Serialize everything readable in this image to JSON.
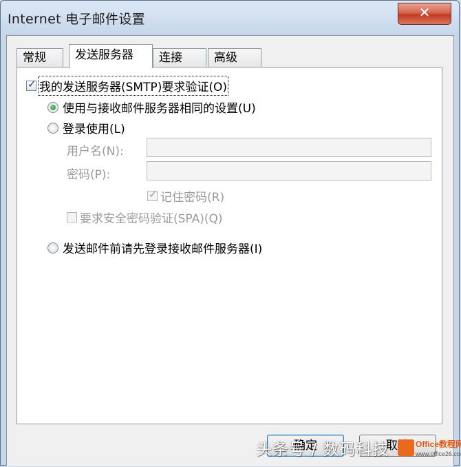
{
  "window": {
    "title": "Internet 电子邮件设置",
    "close_glyph": "✕"
  },
  "tabs": [
    {
      "label": "常规",
      "active": false
    },
    {
      "label": "发送服务器",
      "active": true
    },
    {
      "label": "连接",
      "active": false
    },
    {
      "label": "高级",
      "active": false
    }
  ],
  "smtp_auth": {
    "label": "我的发送服务器(SMTP)要求验证(O)",
    "checked": true
  },
  "same_settings": {
    "label": "使用与接收邮件服务器相同的设置(U)",
    "selected": true
  },
  "login_with": {
    "label": "登录使用(L)",
    "selected": false
  },
  "username": {
    "label": "用户名(N):",
    "value": ""
  },
  "password": {
    "label": "密码(P):",
    "value": ""
  },
  "remember_password": {
    "label": "记住密码(R)",
    "checked": true,
    "enabled": false
  },
  "spa": {
    "label": "要求安全密码验证(SPA)(Q)",
    "checked": false,
    "enabled": false
  },
  "login_before_send": {
    "label": "发送邮件前请先登录接收邮件服务器(I)",
    "selected": false
  },
  "buttons": {
    "ok": "确定",
    "cancel": "取消"
  },
  "watermark": {
    "text": "头条号 / 数码科技",
    "logo_text": "Office教程网",
    "logo_url": "www.office26.com"
  },
  "colors": {
    "accent": "#3c7fb1",
    "close_button": "#c43a22",
    "radio_dot": "#138a2c",
    "logo": "#e96a1f"
  }
}
